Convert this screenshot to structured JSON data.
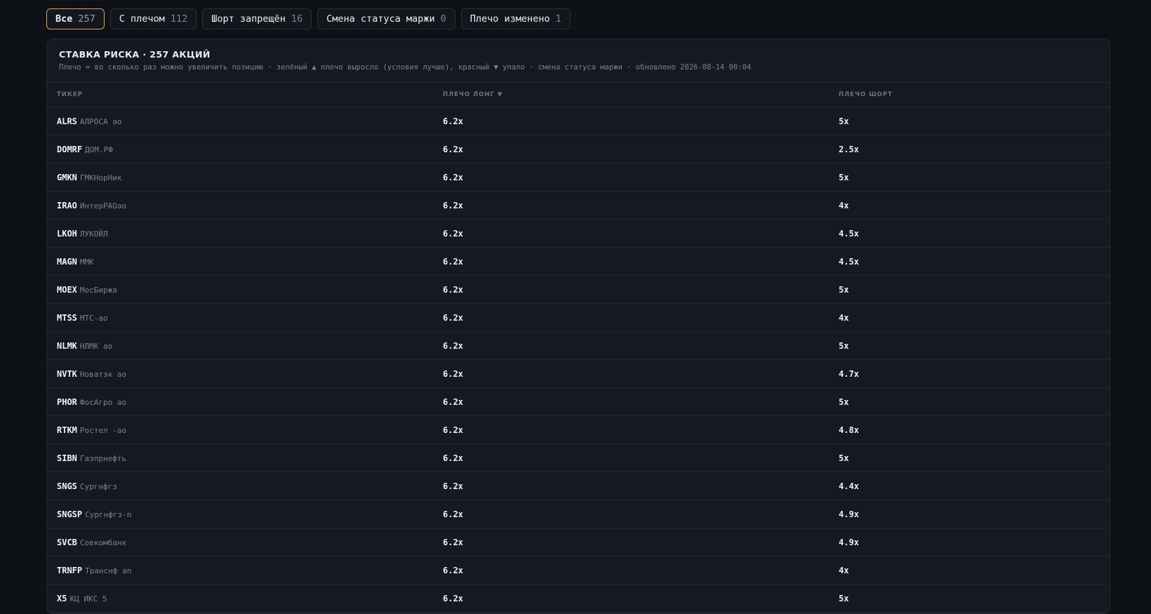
{
  "filters": [
    {
      "label": "Все",
      "count": "257",
      "active": true
    },
    {
      "label": "С плечом",
      "count": "112",
      "active": false
    },
    {
      "label": "Шорт запрещён",
      "count": "16",
      "active": false
    },
    {
      "label": "Смена статуса маржи",
      "count": "0",
      "active": false
    },
    {
      "label": "Плечо изменено",
      "count": "1",
      "active": false
    }
  ],
  "panel": {
    "title": "СТАВКА РИСКА · 257 АКЦИЙ",
    "subtitle": "Плечо = во сколько раз можно увеличить позицию · зелёный ▲ плечо выросло (условия лучше), красный ▼ упало · смена статуса маржи · обновлено 2026-08-14 00:04"
  },
  "table": {
    "columns": [
      "ТИКЕР",
      "ПЛЕЧО ЛОНГ ▼",
      "ПЛЕЧО ШОРТ"
    ],
    "rows": [
      {
        "ticker": "ALRS",
        "name": "АЛРОСА ао",
        "long": "6.2x",
        "short": "5x"
      },
      {
        "ticker": "DOMRF",
        "name": "ДОМ.РФ",
        "long": "6.2x",
        "short": "2.5x"
      },
      {
        "ticker": "GMKN",
        "name": "ГМКНорНик",
        "long": "6.2x",
        "short": "5x"
      },
      {
        "ticker": "IRAO",
        "name": "ИнтерРАОао",
        "long": "6.2x",
        "short": "4x"
      },
      {
        "ticker": "LKOH",
        "name": "ЛУКОЙЛ",
        "long": "6.2x",
        "short": "4.5x"
      },
      {
        "ticker": "MAGN",
        "name": "ММК",
        "long": "6.2x",
        "short": "4.5x"
      },
      {
        "ticker": "MOEX",
        "name": "МосБиржа",
        "long": "6.2x",
        "short": "5x"
      },
      {
        "ticker": "MTSS",
        "name": "МТС-ао",
        "long": "6.2x",
        "short": "4x"
      },
      {
        "ticker": "NLMK",
        "name": "НЛМК ао",
        "long": "6.2x",
        "short": "5x"
      },
      {
        "ticker": "NVTK",
        "name": "Новатэк ао",
        "long": "6.2x",
        "short": "4.7x"
      },
      {
        "ticker": "PHOR",
        "name": "ФосАгро ао",
        "long": "6.2x",
        "short": "5x"
      },
      {
        "ticker": "RTKM",
        "name": "Ростел -ао",
        "long": "6.2x",
        "short": "4.8x"
      },
      {
        "ticker": "SIBN",
        "name": "Газпрнефть",
        "long": "6.2x",
        "short": "5x"
      },
      {
        "ticker": "SNGS",
        "name": "Сургнфгз",
        "long": "6.2x",
        "short": "4.4x"
      },
      {
        "ticker": "SNGSP",
        "name": "Сургнфгз-п",
        "long": "6.2x",
        "short": "4.9x"
      },
      {
        "ticker": "SVCB",
        "name": "Совкомбанк",
        "long": "6.2x",
        "short": "4.9x"
      },
      {
        "ticker": "TRNFP",
        "name": "Транснф ап",
        "long": "6.2x",
        "short": "4x"
      },
      {
        "ticker": "X5",
        "name": "КЦ ИКС 5",
        "long": "6.2x",
        "short": "5x"
      }
    ]
  }
}
